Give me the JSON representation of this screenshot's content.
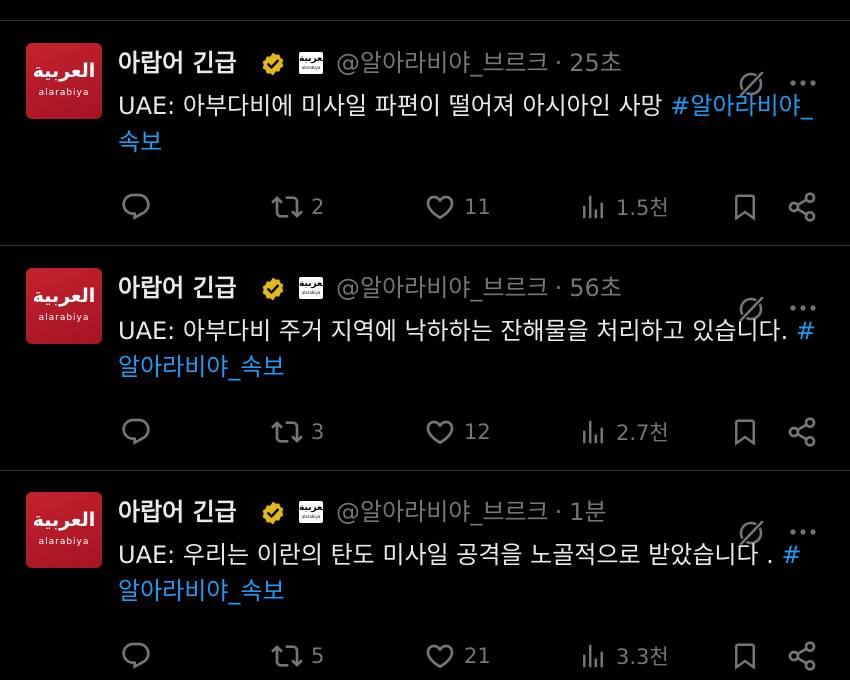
{
  "colors": {
    "background": "#000000",
    "text": "#e7e9ea",
    "muted": "#71767b",
    "hashtag": "#1d9bf0",
    "divider": "#2f3336",
    "avatar_red": "#c4222f",
    "verified_gold": "#e2b719"
  },
  "icons": [
    "reply-icon",
    "retweet-icon",
    "like-icon",
    "views-icon",
    "bookmark-icon",
    "share-icon",
    "grok-icon",
    "more-icon",
    "verified-gold-icon"
  ],
  "avatar_text": {
    "arabic": "العربية",
    "latin": "alarabiya"
  },
  "tweets": [
    {
      "display_name": "아랍어 긴급",
      "handle": "@알아라비야_브르크",
      "separator": "·",
      "time": "25초",
      "text": "UAE: 아부다비에 미사일 파편이 떨어져 아시아인 사망 ",
      "hashtag": "#알아라비야_속보",
      "retweets": "2",
      "likes": "11",
      "views": "1.5천"
    },
    {
      "display_name": "아랍어 긴급",
      "handle": "@알아라비야_브르크",
      "separator": "·",
      "time": "56초",
      "text": "UAE: 아부다비 주거 지역에 낙하하는 잔해물을 처리하고 있습니다. ",
      "hashtag": "#알아라비야_속보",
      "retweets": "3",
      "likes": "12",
      "views": "2.7천"
    },
    {
      "display_name": "아랍어 긴급",
      "handle": "@알아라비야_브르크",
      "separator": "·",
      "time": "1분",
      "text": "UAE: 우리는 이란의 탄도 미사일 공격을 노골적으로 받았습니다 . ",
      "hashtag": "#알아라비야_속보",
      "retweets": "5",
      "likes": "21",
      "views": "3.3천"
    }
  ]
}
